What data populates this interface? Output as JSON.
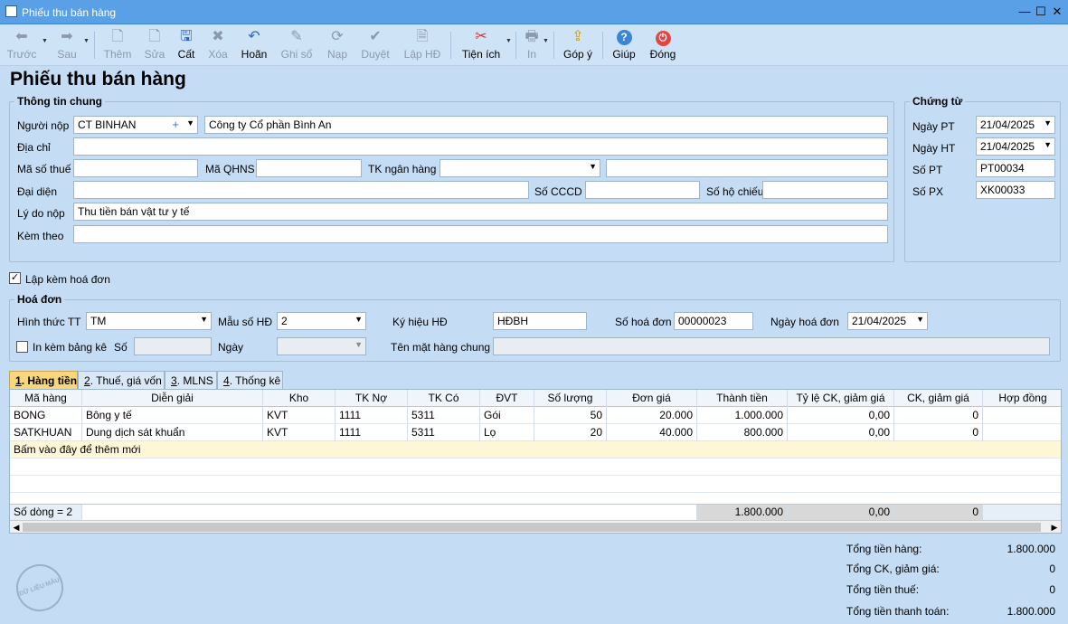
{
  "window": {
    "title": "Phiếu thu bán hàng",
    "min_label": "—",
    "max_label": "☐",
    "close_label": "✕"
  },
  "toolbar": {
    "back": "Trước",
    "next": "Sau",
    "add": "Thêm",
    "edit": "Sửa",
    "save": "Cất",
    "delete": "Xóa",
    "undo": "Hoãn",
    "post": "Ghi sổ",
    "reload": "Nạp",
    "approve": "Duyệt",
    "invoice": "Lập HĐ",
    "utilities": "Tiện ích",
    "print": "In",
    "feedback": "Góp ý",
    "help": "Giúp",
    "close": "Đóng"
  },
  "page_title": "Phiếu thu bán hàng",
  "general": {
    "legend": "Thông tin chung",
    "payer_label": "Người nộp",
    "payer_code": "CT BINHAN",
    "payer_name": "Công ty Cổ phần Bình An",
    "address_label": "Địa chỉ",
    "address": "",
    "tax_code_label": "Mã số thuế",
    "tax_code": "",
    "budget_code_label": "Mã QHNS",
    "budget_code": "",
    "bank_account_label": "TK ngân hàng",
    "bank_account": "",
    "bank_name": "",
    "representative_label": "Đại diện",
    "representative": "",
    "id_card_label": "Số CCCD",
    "id_card": "",
    "passport_label": "Số hộ chiếu",
    "passport": "",
    "reason_label": "Lý do nộp",
    "reason": "Thu tiền bán vật tư y tế",
    "attached_label": "Kèm theo",
    "attached": ""
  },
  "voucher": {
    "legend": "Chứng từ",
    "date_pt_label": "Ngày PT",
    "date_pt": "21/04/2025",
    "date_ht_label": "Ngày HT",
    "date_ht": "21/04/2025",
    "no_pt_label": "Số PT",
    "no_pt": "PT00034",
    "no_px_label": "Số PX",
    "no_px": "XK00033"
  },
  "invoice_check": {
    "label": "Lập kèm hoá đơn",
    "checked": "✓"
  },
  "invoice": {
    "legend": "Hoá đơn",
    "payment_method_label": "Hình thức TT",
    "payment_method": "TM",
    "template_label": "Mẫu số HĐ",
    "template": "2",
    "symbol_label": "Ký hiệu HĐ",
    "symbol": "HĐBH",
    "number_label": "Số hoá đơn",
    "number": "00000023",
    "date_label": "Ngày hoá đơn",
    "date": "21/04/2025",
    "print_with_list_label": "In kèm bảng kê",
    "list_no_label": "Số",
    "list_no": "",
    "list_date_label": "Ngày",
    "list_date": "",
    "general_item_label": "Tên mặt hàng chung",
    "general_item": ""
  },
  "tabs": [
    {
      "key": "1",
      "label": ". Hàng tiền"
    },
    {
      "key": "2",
      "label": ". Thuế, giá vốn"
    },
    {
      "key": "3",
      "label": ". MLNS"
    },
    {
      "key": "4",
      "label": ". Thống kê"
    }
  ],
  "grid": {
    "columns": [
      "Mã hàng",
      "Diễn giải",
      "Kho",
      "TK Nợ",
      "TK Có",
      "ĐVT",
      "Số lượng",
      "Đơn giá",
      "Thành tiền",
      "Tỷ lệ CK, giảm giá",
      "CK, giảm giá",
      "Hợp đồng"
    ],
    "rows": [
      [
        "BONG",
        "Bông y tế",
        "KVT",
        "1111",
        "5311",
        "Gói",
        "50",
        "20.000",
        "1.000.000",
        "0,00",
        "0",
        ""
      ],
      [
        "SATKHUAN",
        "Dung dịch sát khuẩn",
        "KVT",
        "1111",
        "5311",
        "Lọ",
        "20",
        "40.000",
        "800.000",
        "0,00",
        "0",
        ""
      ]
    ],
    "add_row_text": "Bấm vào đây để thêm mới",
    "footer": {
      "count": "Số dòng = 2",
      "total_amount": "1.800.000",
      "total_rate": "0,00",
      "total_discount": "0"
    }
  },
  "totals": {
    "goods_label": "Tổng tiền hàng:",
    "goods": "1.800.000",
    "discount_label": "Tổng CK, giảm giá:",
    "discount": "0",
    "tax_label": "Tổng tiền thuế:",
    "tax": "0",
    "payment_label": "Tổng tiền thanh toán:",
    "payment": "1.800.000"
  },
  "stamp_text": "DỮ LIỆU MẪU",
  "colors": {
    "titlebar": "#5aa0e6",
    "background": "#c4dcf4",
    "active_tab": "#f7d77c",
    "close_icon": "#e04646",
    "help_icon": "#3a86d4"
  }
}
